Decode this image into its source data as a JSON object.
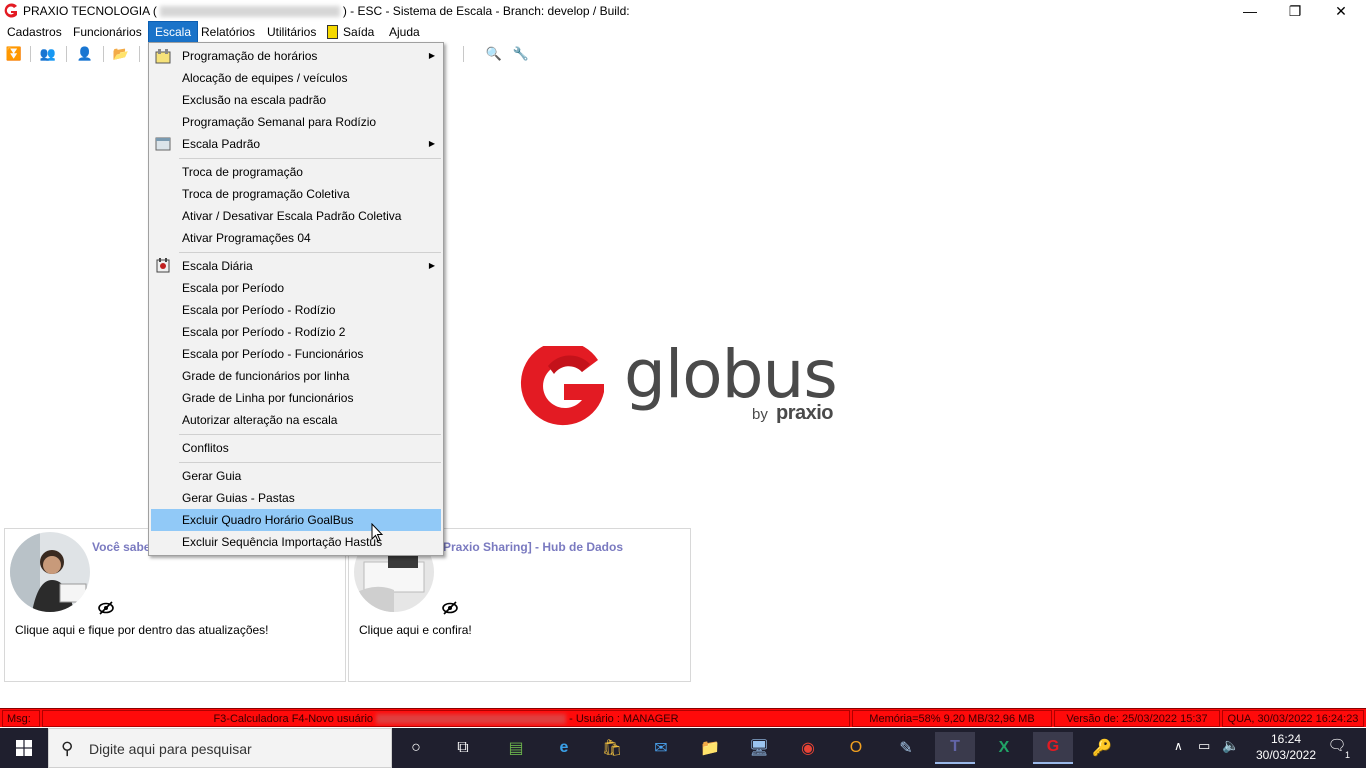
{
  "titlebar": {
    "app_name": "PRAXIO TECNOLOGIA (",
    "suffix": ") - ESC - Sistema de Escala - Branch: develop / Build:",
    "minimize": "—",
    "restore": "❐",
    "close": "✕"
  },
  "menubar": {
    "items": [
      "Cadastros",
      "Funcionários",
      "Escala",
      "Relatórios",
      "Utilitários",
      "Saída",
      "Ajuda"
    ],
    "active": "Escala"
  },
  "dropdown": {
    "items": [
      {
        "label": "Programação de horários",
        "submenu": true,
        "icon": "schedule-icon"
      },
      {
        "label": "Alocação de equipes / veículos"
      },
      {
        "label": "Exclusão na escala padrão"
      },
      {
        "label": "Programação Semanal para Rodízio"
      },
      {
        "label": "Escala Padrão",
        "submenu": true,
        "icon": "calendar-icon"
      },
      {
        "label": "Troca de programação"
      },
      {
        "label": "Troca de programação Coletiva"
      },
      {
        "label": "Ativar / Desativar Escala Padrão Coletiva"
      },
      {
        "label": "Ativar Programações 04"
      },
      {
        "label": "Escala Diária",
        "submenu": true,
        "icon": "daily-schedule-icon"
      },
      {
        "label": "Escala por Período"
      },
      {
        "label": "Escala por Período - Rodízio"
      },
      {
        "label": "Escala por Período - Rodízio 2"
      },
      {
        "label": "Escala por Período - Funcionários"
      },
      {
        "label": "Grade de funcionários por linha"
      },
      {
        "label": "Grade de Linha por funcionários"
      },
      {
        "label": "Autorizar alteração na escala"
      },
      {
        "label": "Conflitos"
      },
      {
        "label": "Gerar Guia"
      },
      {
        "label": "Gerar Guias - Pastas"
      },
      {
        "label": "Excluir Quadro Horário GoalBus",
        "highlighted": true
      },
      {
        "label": "Excluir Sequência Importação Hastus"
      }
    ]
  },
  "logo": {
    "word": "globus",
    "by": "by",
    "praxio": "praxio"
  },
  "cards": [
    {
      "title": "Você sabe",
      "text": "Clique aqui e fique por dentro das atualizações!"
    },
    {
      "title": "[Praxio Sharing] - Hub de Dados",
      "text": "Clique aqui e confira!"
    }
  ],
  "statusbar": {
    "msg": "Msg:",
    "hotkeys": "F3-Calculadora F4-Novo usuário",
    "user": "- Usuário : MANAGER",
    "memory": "Memória=58% 9,20 MB/32,96 MB",
    "version": "Versão de: 25/03/2022 15:37",
    "datetime": "QUA, 30/03/2022 16:24:23"
  },
  "taskbar": {
    "search_placeholder": "Digite aqui para pesquisar",
    "time": "16:24",
    "date": "30/03/2022",
    "notifications": "1"
  },
  "colors": {
    "menu_active": "#1a73c9",
    "menu_highlight": "#91c9f7",
    "statusbar": "#ff0a0a",
    "logo_red": "#e31b23",
    "card_title": "#7a7ac0"
  }
}
